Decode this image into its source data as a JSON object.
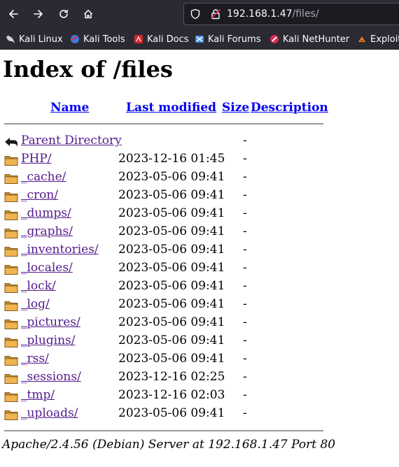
{
  "browser": {
    "url_host": "192.168.1.47",
    "url_path": "/files/",
    "bookmarks": [
      {
        "label": "Kali Linux",
        "icon": "kali-dragon-icon"
      },
      {
        "label": "Kali Tools",
        "icon": "kali-tools-icon"
      },
      {
        "label": "Kali Docs",
        "icon": "kali-docs-icon"
      },
      {
        "label": "Kali Forums",
        "icon": "kali-forums-icon"
      },
      {
        "label": "Kali NetHunter",
        "icon": "kali-nethunter-icon"
      },
      {
        "label": "Exploit",
        "icon": "exploit-db-icon"
      }
    ]
  },
  "page": {
    "title": "Index of /files",
    "columns": {
      "name": "Name",
      "modified": "Last modified",
      "size": "Size",
      "description": "Description"
    },
    "parent": {
      "name": "Parent Directory",
      "size": "-"
    },
    "entries": [
      {
        "name": "PHP/",
        "modified": "2023-12-16 01:45",
        "size": "-"
      },
      {
        "name": "_cache/",
        "modified": "2023-05-06 09:41",
        "size": "-"
      },
      {
        "name": "_cron/",
        "modified": "2023-05-06 09:41",
        "size": "-"
      },
      {
        "name": "_dumps/",
        "modified": "2023-05-06 09:41",
        "size": "-"
      },
      {
        "name": "_graphs/",
        "modified": "2023-05-06 09:41",
        "size": "-"
      },
      {
        "name": "_inventories/",
        "modified": "2023-05-06 09:41",
        "size": "-"
      },
      {
        "name": "_locales/",
        "modified": "2023-05-06 09:41",
        "size": "-"
      },
      {
        "name": "_lock/",
        "modified": "2023-05-06 09:41",
        "size": "-"
      },
      {
        "name": "_log/",
        "modified": "2023-05-06 09:41",
        "size": "-"
      },
      {
        "name": "_pictures/",
        "modified": "2023-05-06 09:41",
        "size": "-"
      },
      {
        "name": "_plugins/",
        "modified": "2023-05-06 09:41",
        "size": "-"
      },
      {
        "name": "_rss/",
        "modified": "2023-05-06 09:41",
        "size": "-"
      },
      {
        "name": "_sessions/",
        "modified": "2023-12-16 02:25",
        "size": "-"
      },
      {
        "name": "_tmp/",
        "modified": "2023-12-16 02:03",
        "size": "-"
      },
      {
        "name": "_uploads/",
        "modified": "2023-05-06 09:41",
        "size": "-"
      }
    ],
    "footer": "Apache/2.4.56 (Debian) Server at 192.168.1.47 Port 80"
  },
  "colors": {
    "chrome": "#2b2a33",
    "link": "#0000ee",
    "visited": "#551a8b",
    "folder": "#e8a33c"
  }
}
